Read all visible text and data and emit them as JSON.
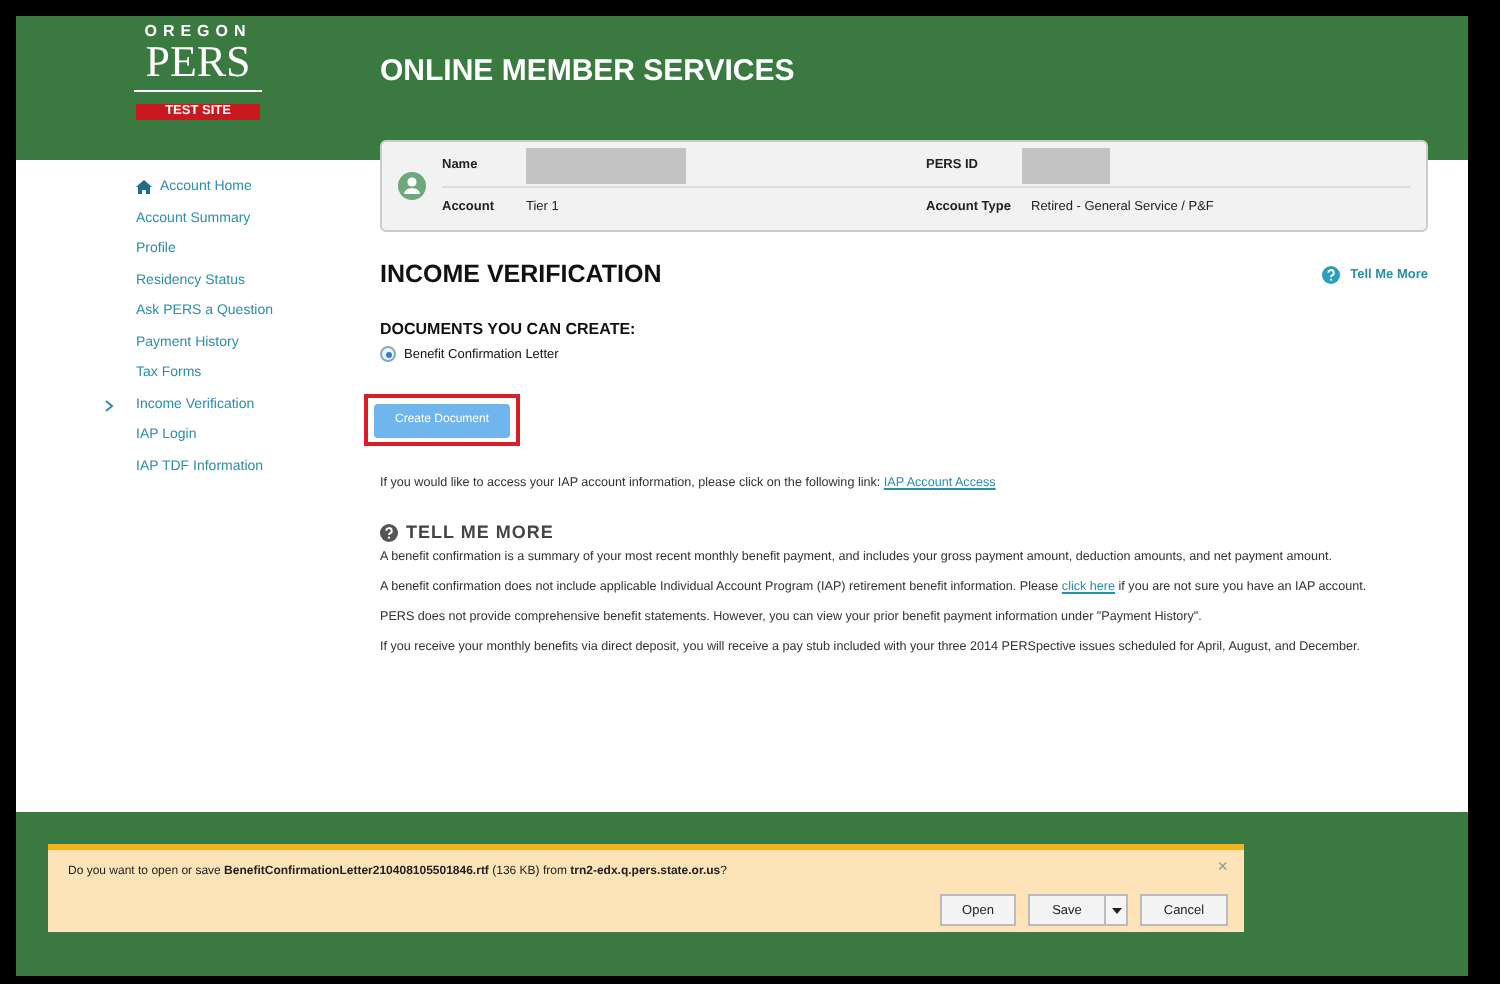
{
  "header": {
    "logo": {
      "top": "OREGON",
      "main": "PERS",
      "badge": "TEST SITE"
    },
    "title": "ONLINE MEMBER SERVICES"
  },
  "account_card": {
    "fields": [
      {
        "label": "Name",
        "redacted": true
      },
      {
        "label": "PERS ID",
        "redacted": true
      },
      {
        "label": "Account",
        "value": "Tier 1",
        "redacted": false
      },
      {
        "label": "Account Type",
        "value": "Retired - General Service / P&F",
        "redacted": false
      }
    ]
  },
  "sidebar": {
    "items": [
      {
        "label": "Account Home",
        "kind": "home",
        "selected": false
      },
      {
        "label": "Account Summary",
        "kind": "link",
        "selected": false
      },
      {
        "label": "Profile",
        "kind": "link",
        "selected": false
      },
      {
        "label": "Residency Status",
        "kind": "link",
        "selected": false
      },
      {
        "label": "Ask PERS a Question",
        "kind": "link",
        "selected": false
      },
      {
        "label": "Payment History",
        "kind": "link",
        "selected": false
      },
      {
        "label": "Tax Forms",
        "kind": "link",
        "selected": false
      },
      {
        "label": "Income Verification",
        "kind": "link",
        "selected": true
      },
      {
        "label": "IAP Login",
        "kind": "link",
        "selected": false
      },
      {
        "label": "IAP TDF Information",
        "kind": "link",
        "selected": false
      }
    ]
  },
  "page": {
    "title": "INCOME VERIFICATION",
    "help_link": "Tell Me More",
    "documents_heading": "DOCUMENTS YOU CAN CREATE:",
    "documents": [
      {
        "label": "Benefit Confirmation Letter",
        "selected": true
      }
    ],
    "create_button": "Create Document",
    "iap_note": {
      "before": "If you would like to access your IAP account information, please click on the following link: ",
      "link": "IAP Account Access"
    }
  },
  "tell_me_more": {
    "heading": "TELL ME MORE",
    "paragraphs": [
      {
        "before": "A benefit confirmation is a summary of your most recent monthly benefit payment, and includes your gross payment amount, deduction amounts, and net payment amount."
      },
      {
        "before": "A benefit confirmation does not include applicable Individual Account Program (IAP) retirement benefit information. Please ",
        "link": "click here",
        "after": " if you are not sure you have an IAP account."
      },
      {
        "before": "PERS does not provide comprehensive benefit statements. However, you can view your prior benefit payment information under \"Payment History\"."
      },
      {
        "before": "If you receive your monthly benefits via direct deposit, you will receive a pay stub included with your three 2014 PERSpective issues scheduled for April, August, and December."
      }
    ]
  },
  "download_bar": {
    "message": "Do you want to open or save **BenefitConfirmationLetter210408105501846.rtf** (136 KB) from **trn2-edx.q.pers.state.or.us**?",
    "close": "×",
    "buttons": [
      {
        "label": "Open",
        "kind": "plain"
      },
      {
        "label": "Save",
        "kind": "split"
      },
      {
        "label": "Cancel",
        "kind": "plain"
      }
    ]
  }
}
